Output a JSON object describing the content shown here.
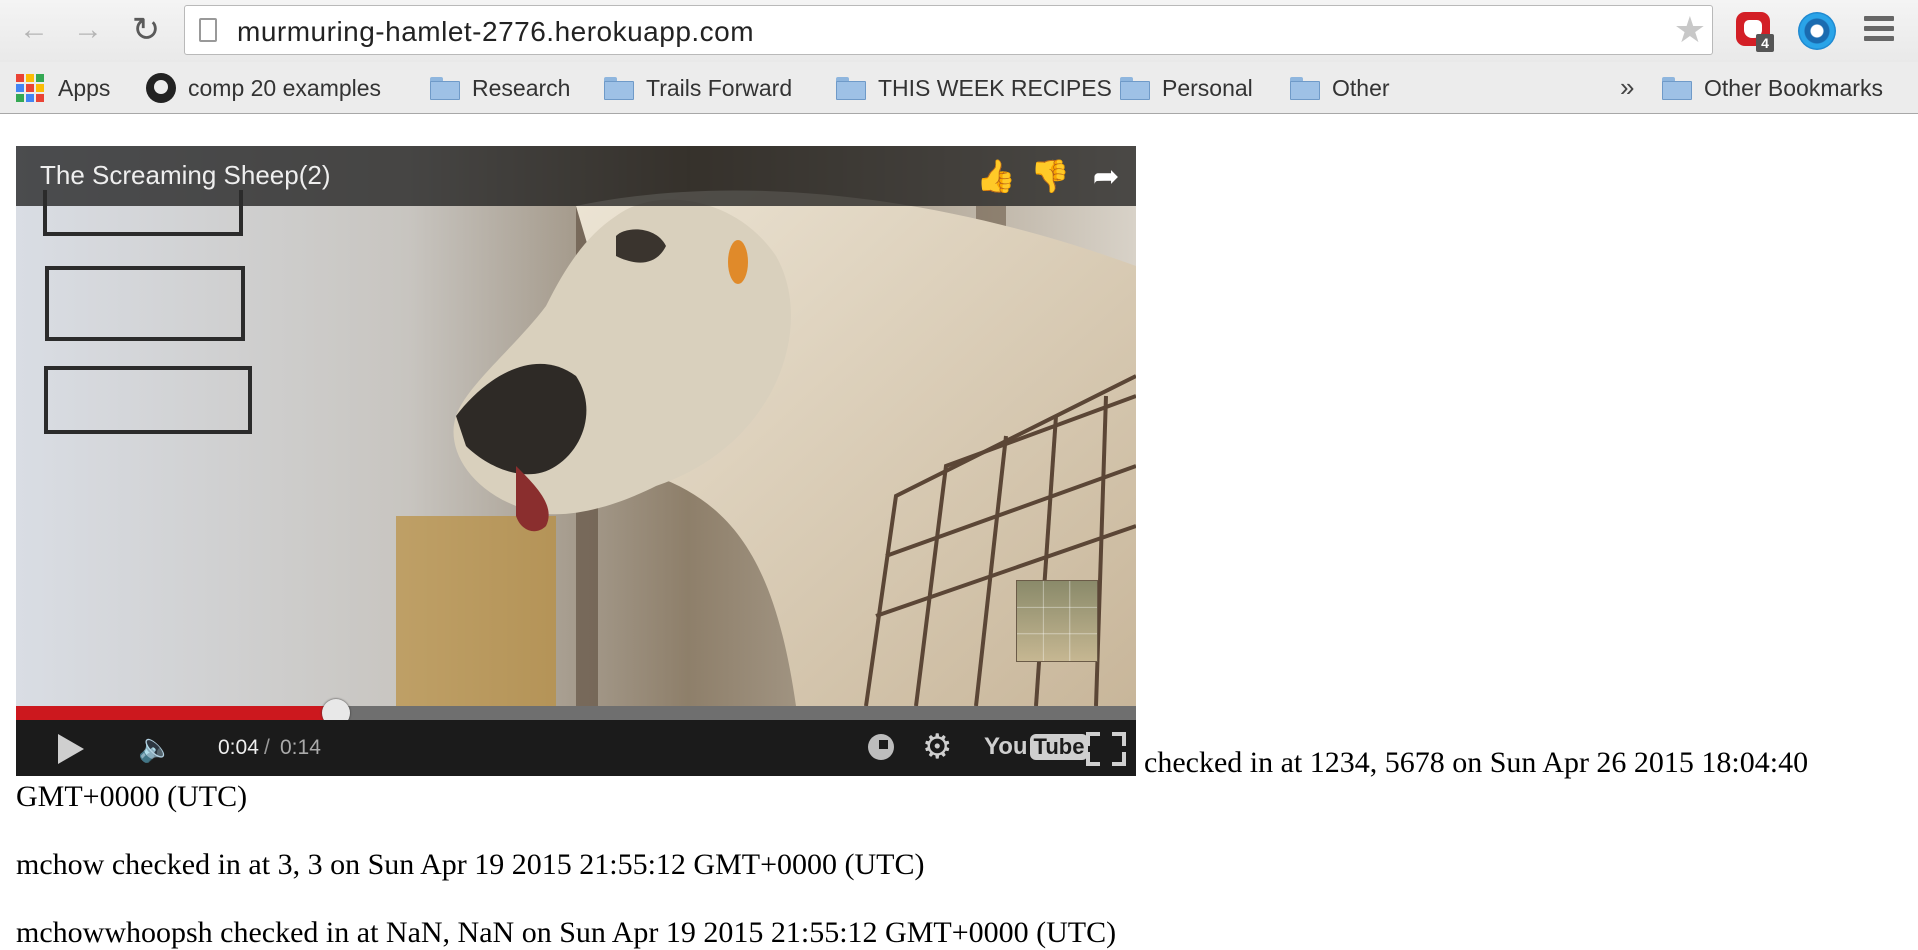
{
  "browser": {
    "url": "murmuring-hamlet-2776.herokuapp.com",
    "extension_badge": "4",
    "bookmarks": [
      {
        "label": "Apps",
        "icon": "apps-grid-icon"
      },
      {
        "label": "comp 20 examples",
        "icon": "github-icon"
      },
      {
        "label": "Research",
        "icon": "folder-icon"
      },
      {
        "label": "Trails Forward",
        "icon": "folder-icon"
      },
      {
        "label": "THIS WEEK RECIPES",
        "icon": "folder-icon"
      },
      {
        "label": "Personal",
        "icon": "folder-icon"
      },
      {
        "label": "Other",
        "icon": "folder-icon"
      }
    ],
    "overflow_chevron": "»",
    "other_bookmarks": "Other Bookmarks"
  },
  "video": {
    "title": "The Screaming Sheep(2)",
    "time_current": "0:04",
    "time_separator": "/",
    "time_total": "0:14",
    "progress_fraction": 0.2857,
    "logo_you": "You",
    "logo_tube": "Tube"
  },
  "checkins": [
    {
      "text_line1": "checked in at 1234, 5678 on Sun Apr 26 2015 18:04:40",
      "text_line2": "GMT+0000 (UTC)"
    },
    {
      "text": "mchow checked in at 3, 3 on Sun Apr 19 2015 21:55:12 GMT+0000 (UTC)"
    },
    {
      "text": "mchowwhoopsh checked in at NaN, NaN on Sun Apr 19 2015 21:55:12 GMT+0000 (UTC)"
    }
  ]
}
